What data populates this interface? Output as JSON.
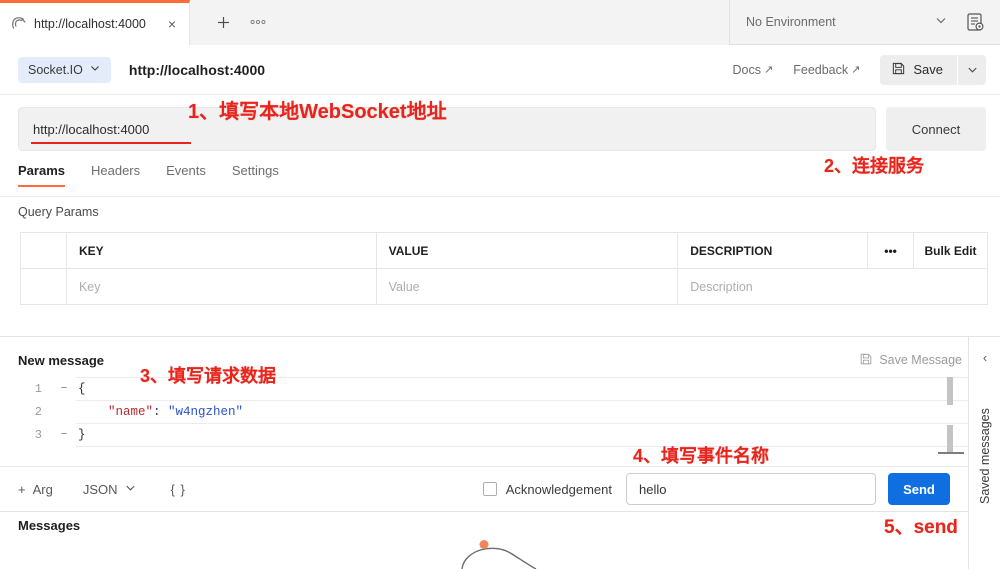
{
  "tabstrip": {
    "tab": {
      "label": "http://localhost:4000",
      "icon": "socketio-icon",
      "close": "×"
    },
    "new_tab": "+",
    "more": "•••",
    "environment": {
      "name": "No Environment",
      "caret": "⌄",
      "eye_icon": "environment-quick-look-icon"
    }
  },
  "request_header": {
    "protocol": "Socket.IO",
    "protocol_caret": "⌄",
    "url_title": "http://localhost:4000",
    "docs": "Docs",
    "feedback": "Feedback",
    "external_arrow": "↗",
    "save": "Save",
    "save_caret": "⌄"
  },
  "url_bar": {
    "value": "http://localhost:4000",
    "connect": "Connect"
  },
  "tabs": [
    {
      "label": "Params",
      "active": true
    },
    {
      "label": "Headers",
      "active": false
    },
    {
      "label": "Events",
      "active": false
    },
    {
      "label": "Settings",
      "active": false
    }
  ],
  "query_params": {
    "title": "Query Params",
    "headers": [
      "KEY",
      "VALUE",
      "DESCRIPTION"
    ],
    "dots": "•••",
    "bulk_edit": "Bulk Edit",
    "row": {
      "key": "Key",
      "value": "Value",
      "description": "Description"
    }
  },
  "new_message": {
    "title": "New message",
    "save_message": "Save Message",
    "save_icon": "floppy-disk-icon",
    "code": [
      {
        "number": "1",
        "fold": "−",
        "tokens": [
          {
            "t": "brace",
            "v": "{"
          }
        ]
      },
      {
        "number": "2",
        "fold": "",
        "tokens": [
          {
            "t": "key",
            "v": "    \"name\""
          },
          {
            "t": "colon",
            "v": ": "
          },
          {
            "t": "str",
            "v": "\"w4ngzhen\""
          }
        ]
      },
      {
        "number": "3",
        "fold": "−",
        "tokens": [
          {
            "t": "brace",
            "v": "}"
          }
        ]
      }
    ]
  },
  "arg_toolbar": {
    "add_arg": "Arg",
    "add_icon": "+",
    "body_type": "JSON",
    "body_caret": "⌄",
    "beautify": "{ }",
    "acknowledgement": "Acknowledgement",
    "event_name": "hello",
    "send": "Send"
  },
  "messages": {
    "title": "Messages"
  },
  "saved_messages_rail": {
    "label": "Saved messages",
    "chevron": "‹"
  },
  "annotations": [
    {
      "id": "anno1",
      "text": "1、填写本地WebSocket地址"
    },
    {
      "id": "anno2",
      "text": "2、连接服务"
    },
    {
      "id": "anno3",
      "text": "3、填写请求数据"
    },
    {
      "id": "anno4",
      "text": "4、填写事件名称"
    },
    {
      "id": "anno5",
      "text": "5、send"
    }
  ],
  "colors": {
    "accent_orange": "#ff6c37",
    "annotation_red": "#e8251c",
    "send_blue": "#0f6fe0",
    "protocol_badge": "#e4ecfb"
  }
}
